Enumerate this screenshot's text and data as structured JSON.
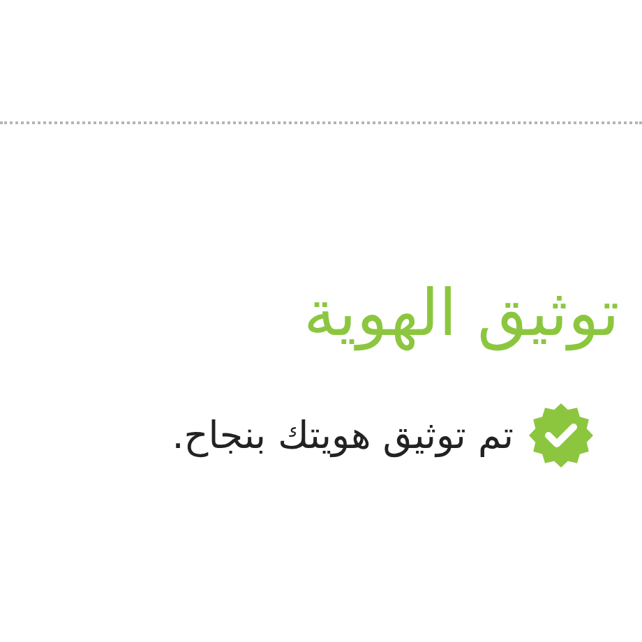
{
  "title": "توثيق الهوية",
  "message": {
    "text": "تم توثيق هويتك بنجاح.",
    "verified": true
  }
}
